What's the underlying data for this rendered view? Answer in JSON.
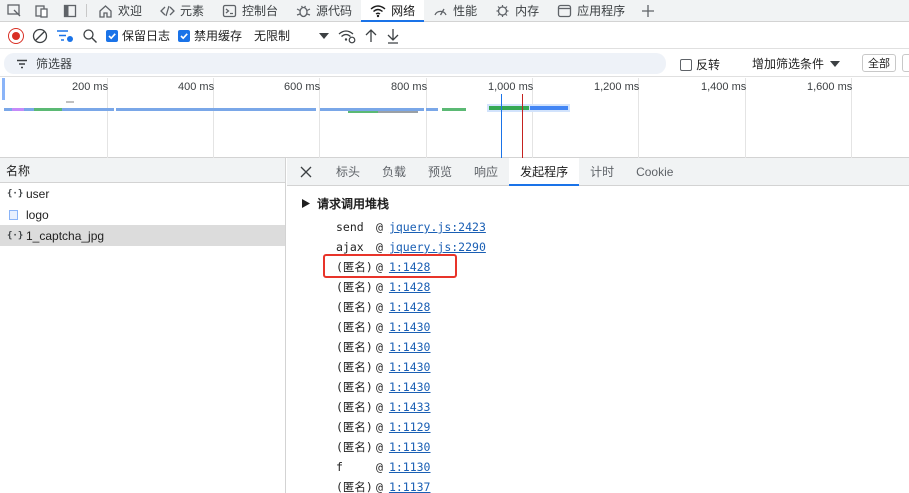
{
  "tabs": [
    {
      "label": "欢迎",
      "icon": "home-icon"
    },
    {
      "label": "元素",
      "icon": "code-icon"
    },
    {
      "label": "控制台",
      "icon": "console-icon"
    },
    {
      "label": "源代码",
      "icon": "bug-icon"
    },
    {
      "label": "网络",
      "icon": "wifi-icon",
      "active": true
    },
    {
      "label": "性能",
      "icon": "gauge-icon"
    },
    {
      "label": "内存",
      "icon": "memory-icon"
    },
    {
      "label": "应用程序",
      "icon": "application-icon"
    }
  ],
  "toolbar": {
    "preserve_log": "保留日志",
    "disable_cache": "禁用缓存",
    "throttle": "无限制"
  },
  "filter": {
    "placeholder": "筛选器",
    "invert": "反转",
    "add_filter": "增加筛选条件",
    "all": "全部"
  },
  "timeline": {
    "ticks": [
      "200 ms",
      "400 ms",
      "600 ms",
      "800 ms",
      "1,000 ms",
      "1,200 ms",
      "1,400 ms",
      "1,600 ms"
    ]
  },
  "requests": {
    "header": "名称",
    "items": [
      {
        "name": "user",
        "icon": "json-icon"
      },
      {
        "name": "logo",
        "icon": "document-icon"
      },
      {
        "name": "1_captcha_jpg",
        "icon": "json-icon",
        "selected": true
      }
    ]
  },
  "detail": {
    "tabs": [
      "标头",
      "负载",
      "预览",
      "响应",
      "发起程序",
      "计时",
      "Cookie"
    ],
    "active_tab": "发起程序",
    "section_title": "请求调用堆栈",
    "stack": [
      {
        "fn": "send",
        "loc": "jquery.js:2423"
      },
      {
        "fn": "ajax",
        "loc": "jquery.js:2290"
      },
      {
        "fn": "(匿名)",
        "loc": "1:1428"
      },
      {
        "fn": "(匿名)",
        "loc": "1:1428"
      },
      {
        "fn": "(匿名)",
        "loc": "1:1428"
      },
      {
        "fn": "(匿名)",
        "loc": "1:1430"
      },
      {
        "fn": "(匿名)",
        "loc": "1:1430"
      },
      {
        "fn": "(匿名)",
        "loc": "1:1430"
      },
      {
        "fn": "(匿名)",
        "loc": "1:1430"
      },
      {
        "fn": "(匿名)",
        "loc": "1:1433"
      },
      {
        "fn": "(匿名)",
        "loc": "1:1129"
      },
      {
        "fn": "(匿名)",
        "loc": "1:1130"
      },
      {
        "fn": "f",
        "loc": "1:1130"
      },
      {
        "fn": "(匿名)",
        "loc": "1:1137"
      }
    ]
  },
  "colors": {
    "accent": "#1a73e8",
    "record": "#d93025",
    "highlight_box": "#e8342a",
    "link": "#1a5fb4"
  }
}
